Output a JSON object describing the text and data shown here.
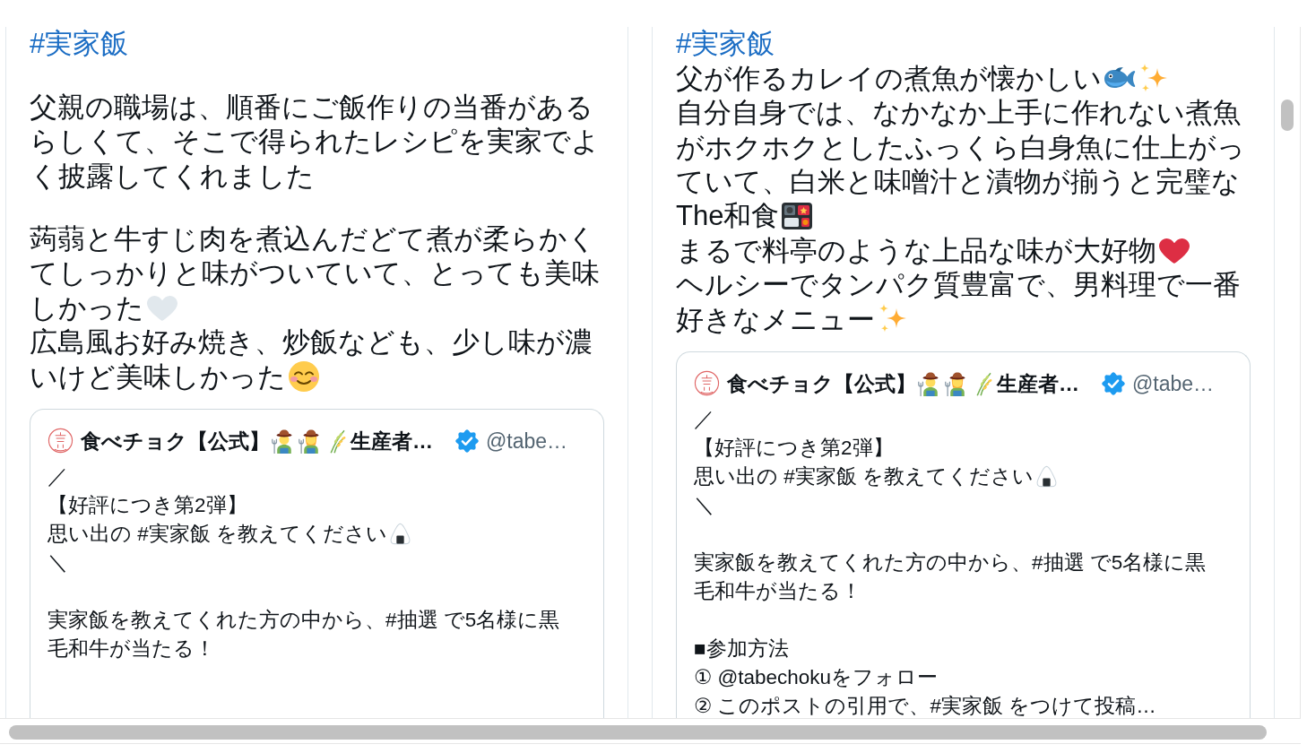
{
  "posts": [
    {
      "paragraphs": [
        {
          "lines": [
            {
              "parts": [
                {
                  "kind": "hashtag",
                  "text": "#実家飯"
                }
              ]
            }
          ]
        },
        {
          "lines": [
            {
              "parts": [
                {
                  "kind": "text",
                  "text": "父親の職場は、順番にご飯作りの当番がある"
                }
              ]
            },
            {
              "parts": [
                {
                  "kind": "text",
                  "text": "らしくて、そこで得られたレシピを実家でよ"
                }
              ]
            },
            {
              "parts": [
                {
                  "kind": "text",
                  "text": "く披露してくれました"
                }
              ]
            }
          ]
        },
        {
          "lines": [
            {
              "parts": [
                {
                  "kind": "text",
                  "text": "蒟蒻と牛すじ肉を煮込んだどて煮が柔らかく"
                }
              ]
            },
            {
              "parts": [
                {
                  "kind": "text",
                  "text": "てしっかりと味がついていて、とっても美味"
                }
              ]
            },
            {
              "parts": [
                {
                  "kind": "text",
                  "text": "しかった"
                },
                {
                  "kind": "paleheart"
                }
              ]
            },
            {
              "parts": [
                {
                  "kind": "text",
                  "text": "広島風お好み焼き、炒飯なども、少し味が濃"
                }
              ]
            },
            {
              "parts": [
                {
                  "kind": "text",
                  "text": "いけど美味しかった"
                },
                {
                  "kind": "blush"
                }
              ]
            }
          ]
        }
      ],
      "quote": {
        "name": [
          {
            "kind": "text",
            "text": "食べチョク【公式】"
          },
          {
            "kind": "farmer"
          },
          {
            "kind": "farmerwoman"
          },
          {
            "kind": "rice"
          },
          {
            "kind": "text",
            "text": "生産者…"
          }
        ],
        "verified": true,
        "handle": "@tabe…",
        "paragraphs": [
          {
            "lines": [
              {
                "parts": [
                  {
                    "kind": "text",
                    "text": "／"
                  }
                ]
              },
              {
                "parts": [
                  {
                    "kind": "text",
                    "text": "【好評につき第2弾】"
                  }
                ]
              },
              {
                "parts": [
                  {
                    "kind": "text",
                    "text": "思い出の #実家飯 を教えてください"
                  },
                  {
                    "kind": "onigiri"
                  }
                ]
              },
              {
                "parts": [
                  {
                    "kind": "text",
                    "text": "＼"
                  }
                ]
              }
            ]
          },
          {
            "lines": [
              {
                "parts": [
                  {
                    "kind": "text",
                    "text": "実家飯を教えてくれた方の中から、#抽選 で5名様に黒"
                  }
                ]
              },
              {
                "parts": [
                  {
                    "kind": "text",
                    "text": "毛和牛が当たる！"
                  }
                ]
              }
            ]
          }
        ]
      }
    },
    {
      "paragraphs": [
        {
          "lines": [
            {
              "parts": [
                {
                  "kind": "hashtag",
                  "text": "#実家飯"
                }
              ]
            },
            {
              "parts": [
                {
                  "kind": "text",
                  "text": "父が作るカレイの煮魚が懐かしい"
                },
                {
                  "kind": "fish"
                },
                {
                  "kind": "sparkles"
                }
              ]
            },
            {
              "parts": [
                {
                  "kind": "text",
                  "text": "自分自身では、なかなか上手に作れない煮魚"
                }
              ]
            },
            {
              "parts": [
                {
                  "kind": "text",
                  "text": "がホクホクとしたふっくら白身魚に仕上がっ"
                }
              ]
            },
            {
              "parts": [
                {
                  "kind": "text",
                  "text": "ていて、白米と味噌汁と漬物が揃うと完璧な"
                }
              ]
            },
            {
              "parts": [
                {
                  "kind": "text",
                  "text": "The和食"
                },
                {
                  "kind": "bento"
                }
              ]
            },
            {
              "parts": [
                {
                  "kind": "text",
                  "text": "まるで料亭のような上品な味が大好物"
                },
                {
                  "kind": "heart"
                }
              ]
            },
            {
              "parts": [
                {
                  "kind": "text",
                  "text": "ヘルシーでタンパク質豊富で、男料理で一番"
                }
              ]
            },
            {
              "parts": [
                {
                  "kind": "text",
                  "text": "好きなメニュー"
                },
                {
                  "kind": "sparkles"
                }
              ]
            }
          ]
        }
      ],
      "quote": {
        "name": [
          {
            "kind": "text",
            "text": "食べチョク【公式】"
          },
          {
            "kind": "farmer"
          },
          {
            "kind": "farmerwoman"
          },
          {
            "kind": "rice"
          },
          {
            "kind": "text",
            "text": "生産者…"
          }
        ],
        "verified": true,
        "handle": "@tabe…",
        "paragraphs": [
          {
            "lines": [
              {
                "parts": [
                  {
                    "kind": "text",
                    "text": "／"
                  }
                ]
              },
              {
                "parts": [
                  {
                    "kind": "text",
                    "text": "【好評につき第2弾】"
                  }
                ]
              },
              {
                "parts": [
                  {
                    "kind": "text",
                    "text": "思い出の #実家飯 を教えてください"
                  },
                  {
                    "kind": "onigiri"
                  }
                ]
              },
              {
                "parts": [
                  {
                    "kind": "text",
                    "text": "＼"
                  }
                ]
              }
            ]
          },
          {
            "lines": [
              {
                "parts": [
                  {
                    "kind": "text",
                    "text": "実家飯を教えてくれた方の中から、#抽選 で5名様に黒"
                  }
                ]
              },
              {
                "parts": [
                  {
                    "kind": "text",
                    "text": "毛和牛が当たる！"
                  }
                ]
              }
            ]
          },
          {
            "lines": [
              {
                "parts": [
                  {
                    "kind": "text",
                    "text": "■参加方法"
                  }
                ]
              },
              {
                "parts": [
                  {
                    "kind": "text",
                    "text": "① @tabechokuをフォロー"
                  }
                ]
              },
              {
                "parts": [
                  {
                    "kind": "text",
                    "text": "② このポストの引用で、#実家飯 をつけて投稿…"
                  }
                ]
              }
            ]
          }
        ]
      }
    }
  ]
}
